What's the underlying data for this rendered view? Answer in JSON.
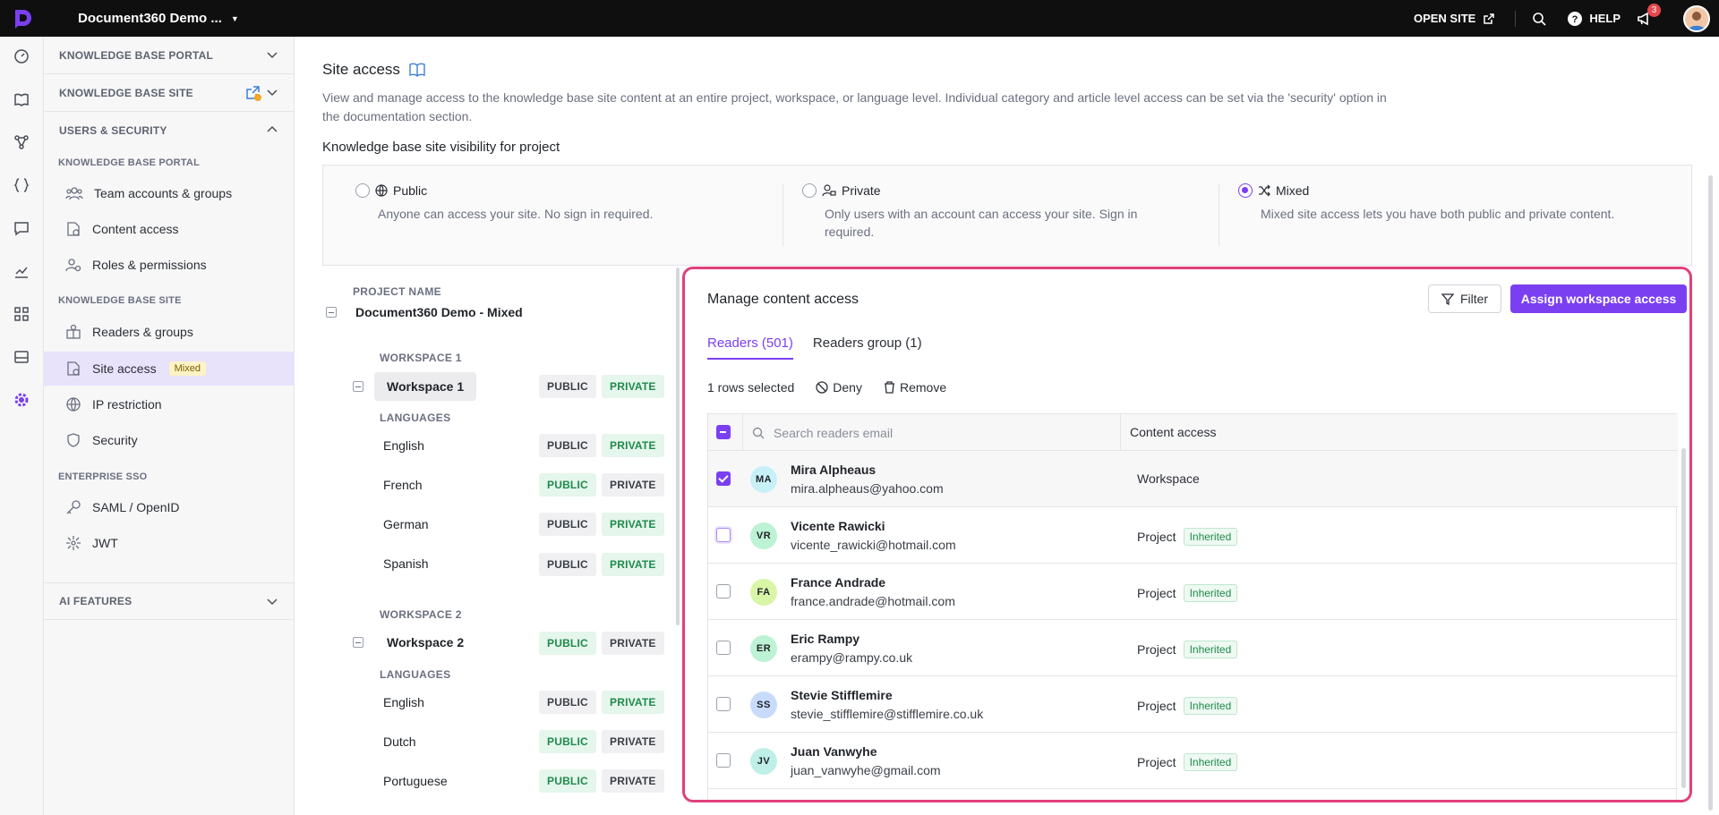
{
  "topbar": {
    "project_name": "Document360 Demo ...",
    "open_site": "OPEN SITE",
    "help": "HELP",
    "notification_count": "3"
  },
  "sidenav": {
    "sections": {
      "kb_portal": "KNOWLEDGE BASE PORTAL",
      "kb_site": "KNOWLEDGE BASE SITE",
      "users_security": "USERS & SECURITY",
      "ai_features": "AI FEATURES"
    },
    "sub_heads": {
      "kb_portal": "KNOWLEDGE BASE PORTAL",
      "kb_site": "KNOWLEDGE BASE SITE",
      "enterprise_sso": "ENTERPRISE SSO"
    },
    "items": {
      "team_accounts": "Team accounts & groups",
      "content_access": "Content access",
      "roles": "Roles & permissions",
      "readers_groups": "Readers & groups",
      "site_access": "Site access",
      "site_access_tag": "Mixed",
      "ip_restriction": "IP restriction",
      "security": "Security",
      "saml": "SAML / OpenID",
      "jwt": "JWT"
    }
  },
  "page": {
    "title": "Site access",
    "description": "View and manage access to the knowledge base site content at an entire project, workspace, or language level. Individual category and article level access can be set via the 'security' option in the documentation section.",
    "visibility_label": "Knowledge base site visibility for project",
    "options": [
      {
        "label": "Public",
        "desc": "Anyone can access your site. No sign in required."
      },
      {
        "label": "Private",
        "desc": "Only users with an account can access your site. Sign in required."
      },
      {
        "label": "Mixed",
        "desc": "Mixed site access lets you have both public and private content."
      }
    ],
    "selected_option": "Mixed"
  },
  "tree": {
    "project_head": "PROJECT NAME",
    "project_name": "Document360 Demo - Mixed",
    "workspace1_head": "WORKSPACE 1",
    "workspace1_name": "Workspace 1",
    "workspace2_head": "WORKSPACE 2",
    "workspace2_name": "Workspace 2",
    "languages_head": "LANGUAGES",
    "public_label": "PUBLIC",
    "private_label": "PRIVATE",
    "ws1_languages": [
      "English",
      "French",
      "German",
      "Spanish"
    ],
    "ws2_languages": [
      "English",
      "Dutch",
      "Portuguese"
    ]
  },
  "modal": {
    "title": "Manage content access",
    "filter": "Filter",
    "assign": "Assign workspace access",
    "tab_readers": "Readers (501)",
    "tab_groups": "Readers group (1)",
    "selected_count": "1 rows selected",
    "deny": "Deny",
    "remove": "Remove",
    "search_placeholder": "Search readers email",
    "col_access": "Content access",
    "inherited": "Inherited",
    "colors": {
      "accent": "#7b3ff2",
      "highlight_border": "#e0407a"
    },
    "rows": [
      {
        "initials": "MA",
        "name": "Mira Alpheaus",
        "email": "mira.alpheaus@yahoo.com",
        "access": "Workspace",
        "inherited": false,
        "checked": true,
        "color": "#c7f0f7"
      },
      {
        "initials": "VR",
        "name": "Vicente Rawicki",
        "email": "vicente_rawicki@hotmail.com",
        "access": "Project",
        "inherited": true,
        "checked": false,
        "color": "#bdf2d4"
      },
      {
        "initials": "FA",
        "name": "France Andrade",
        "email": "france.andrade@hotmail.com",
        "access": "Project",
        "inherited": true,
        "checked": false,
        "color": "#d8f5a8"
      },
      {
        "initials": "ER",
        "name": "Eric Rampy",
        "email": "erampy@rampy.co.uk",
        "access": "Project",
        "inherited": true,
        "checked": false,
        "color": "#bdf2d4"
      },
      {
        "initials": "SS",
        "name": "Stevie Stifflemire",
        "email": "stevie_stifflemire@stifflemire.co.uk",
        "access": "Project",
        "inherited": true,
        "checked": false,
        "color": "#c9dbfb"
      },
      {
        "initials": "JV",
        "name": "Juan Vanwyhe",
        "email": "juan_vanwyhe@gmail.com",
        "access": "Project",
        "inherited": true,
        "checked": false,
        "color": "#bff0e8"
      }
    ]
  }
}
